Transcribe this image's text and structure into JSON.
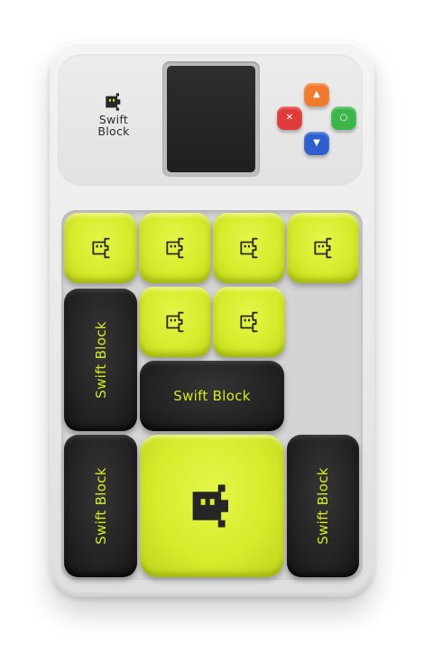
{
  "brand": {
    "line1": "Swift",
    "line2": "Block",
    "icon": "robot-head-icon"
  },
  "screen": {
    "state": "off"
  },
  "controls": {
    "up": {
      "icon": "triangle-up-icon",
      "glyph": "▲",
      "color": "#f07a2e"
    },
    "left": {
      "icon": "close-x-icon",
      "glyph": "✕",
      "color": "#e03a3a"
    },
    "right": {
      "icon": "circle-icon",
      "glyph": "○",
      "color": "#3cb54a"
    },
    "down": {
      "icon": "triangle-down-icon",
      "glyph": "▼",
      "color": "#2d5fcf"
    }
  },
  "colors": {
    "tile_yellow": "#d7ec2c",
    "tile_black": "#232323",
    "label": "#d6ea24"
  },
  "tiles": {
    "vertical_left_top": "Swift Block",
    "horizontal_middle": "Swift Block",
    "vertical_left_bottom": "Swift Block",
    "vertical_right_bottom": "Swift Block",
    "small_icon": "robot-icon",
    "big_icon": "robot-head-icon"
  }
}
